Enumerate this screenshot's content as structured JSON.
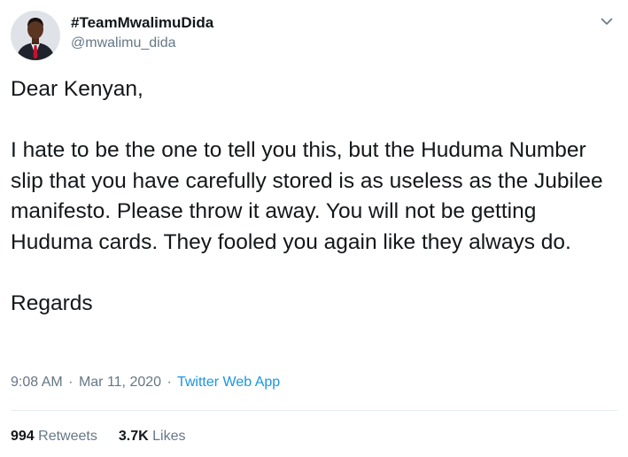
{
  "author": {
    "display_name": "#TeamMwalimuDida",
    "handle": "@mwalimu_dida",
    "avatar_icon": "profile-photo-man-in-suit"
  },
  "menu": {
    "icon": "chevron-down-icon"
  },
  "tweet": {
    "text": "Dear Kenyan,\n\nI hate to be the one to tell you this, but the Huduma Number slip that you have carefully stored is as useless as the Jubilee manifesto. Please throw it away. You will not be getting Huduma cards. They fooled you again like they always do.\n\nRegards"
  },
  "meta": {
    "time": "9:08 AM",
    "separator": "·",
    "date": "Mar 11, 2020",
    "source": "Twitter Web App"
  },
  "stats": {
    "retweets_count": "994",
    "retweets_label": "Retweets",
    "likes_count": "3.7K",
    "likes_label": "Likes"
  },
  "colors": {
    "text": "#14171a",
    "secondary": "#657786",
    "link": "#1b95e0",
    "divider": "#e6ecf0"
  }
}
